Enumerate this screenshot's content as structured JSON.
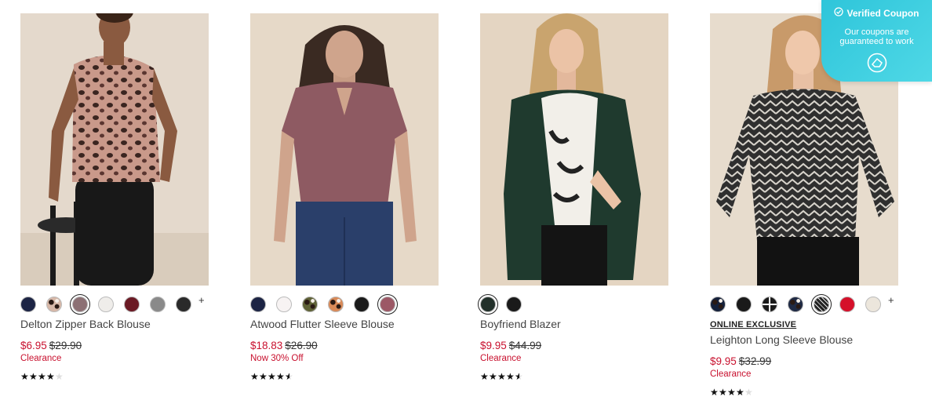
{
  "products": [
    {
      "name": "Delton Zipper Back Blouse",
      "sale_price": "$6.95",
      "original_price": "$29.90",
      "promo": "Clearance",
      "online_exclusive": "",
      "rating": 4,
      "swatches": [
        {
          "color": "#1c2444",
          "icon": "navy-swatch-icon"
        },
        {
          "color": "#d7b8a8",
          "icon": "leopard-swatch-icon",
          "pattern": "leopard"
        },
        {
          "color": "#8c7074",
          "icon": "mauve-swatch-icon",
          "selected": true
        },
        {
          "color": "#efedea",
          "icon": "ivory-swatch-icon"
        },
        {
          "color": "#6b1a24",
          "icon": "burgundy-swatch-icon"
        },
        {
          "color": "#8a8a8a",
          "icon": "grey-swatch-icon"
        },
        {
          "color": "#2a2a2a",
          "icon": "black-swatch-icon"
        }
      ],
      "more": "+"
    },
    {
      "name": "Atwood Flutter Sleeve Blouse",
      "sale_price": "$18.83",
      "original_price": "$26.90",
      "promo": "Now 30% Off",
      "online_exclusive": "",
      "rating": 4.5,
      "swatches": [
        {
          "color": "#1c2444",
          "icon": "navy-swatch-icon"
        },
        {
          "color": "#f7f3f3",
          "icon": "white-swatch-icon"
        },
        {
          "color": "#5f6237",
          "icon": "olive-print-swatch-icon",
          "pattern": "dots"
        },
        {
          "color": "#d98a58",
          "icon": "animal-print-swatch-icon",
          "pattern": "dots"
        },
        {
          "color": "#1a1a1a",
          "icon": "black-swatch-icon"
        },
        {
          "color": "#9c5866",
          "icon": "rose-swatch-icon",
          "selected": true
        }
      ],
      "more": ""
    },
    {
      "name": "Boyfriend Blazer",
      "sale_price": "$9.95",
      "original_price": "$44.99",
      "promo": "Clearance",
      "online_exclusive": "",
      "rating": 4.5,
      "swatches": [
        {
          "color": "#22302a",
          "icon": "forest-green-swatch-icon",
          "selected": true
        },
        {
          "color": "#1a1a1a",
          "icon": "black-swatch-icon"
        }
      ],
      "more": ""
    },
    {
      "name": "Leighton Long Sleeve Blouse",
      "sale_price": "$9.95",
      "original_price": "$32.99",
      "promo": "Clearance",
      "online_exclusive": "ONLINE EXCLUSIVE",
      "rating": 4,
      "swatches": [
        {
          "color": "#14203a",
          "icon": "navy-floral-swatch-icon",
          "pattern": "dots"
        },
        {
          "color": "#1a1a1a",
          "icon": "black-swatch-icon"
        },
        {
          "color": "#1a1a1a",
          "icon": "black-geo-swatch-icon",
          "pattern": "cross"
        },
        {
          "color": "#1f2a44",
          "icon": "navy-print-swatch-icon",
          "pattern": "dots"
        },
        {
          "color": "#222222",
          "icon": "black-chevron-swatch-icon",
          "pattern": "stripes",
          "selected": true
        },
        {
          "color": "#d5102a",
          "icon": "red-swatch-icon"
        },
        {
          "color": "#ece6dc",
          "icon": "cream-swatch-icon"
        }
      ],
      "more": "+"
    }
  ],
  "coupon": {
    "title": "Verified Coupon",
    "subtitle": "Our coupons are guaranteed to work",
    "check_icon": "check-circle-icon",
    "logo_icon": "coupon-logo-icon"
  }
}
